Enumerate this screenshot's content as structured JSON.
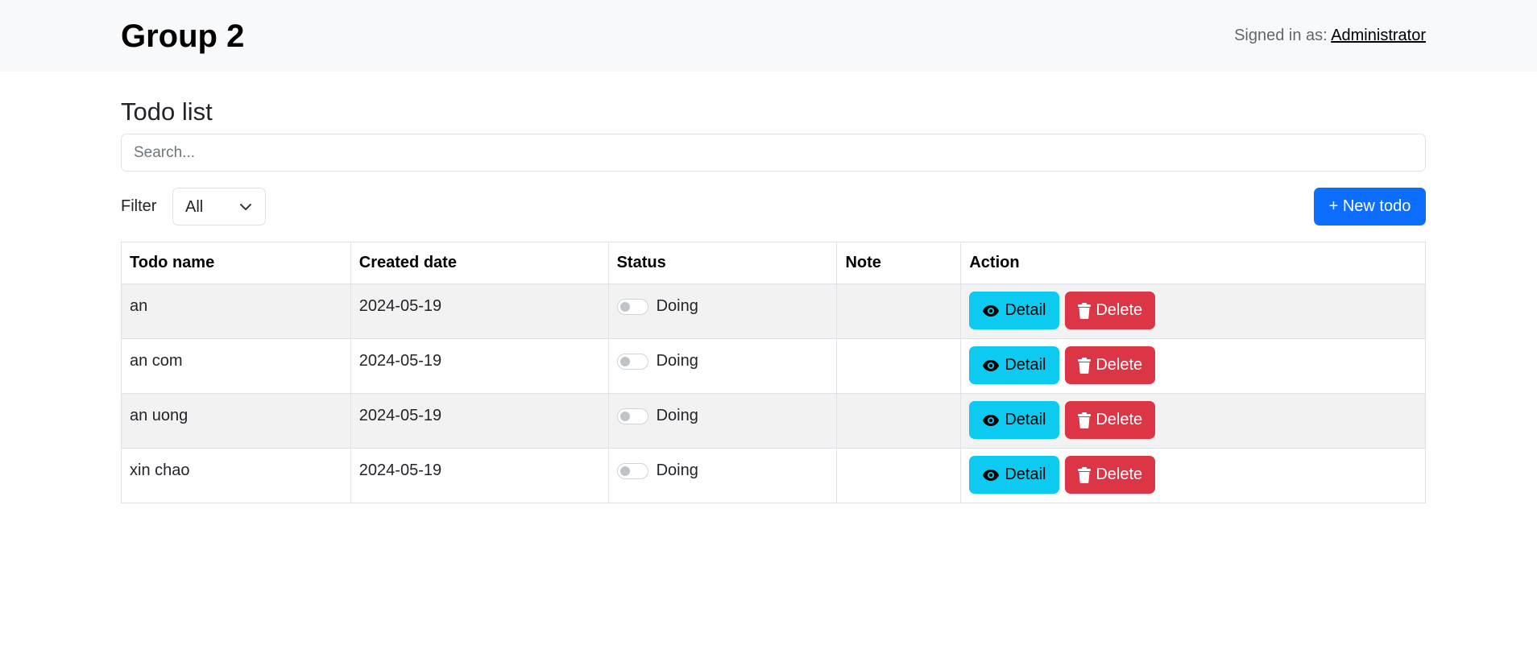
{
  "header": {
    "brand": "Group 2",
    "signed_in_label": "Signed in as:",
    "user": "Administrator"
  },
  "main": {
    "title": "Todo list",
    "search_placeholder": "Search...",
    "filter_label": "Filter",
    "filter_value": "All",
    "new_button": "+ New todo"
  },
  "table": {
    "columns": [
      "Todo name",
      "Created date",
      "Status",
      "Note",
      "Action"
    ],
    "rows": [
      {
        "name": "an",
        "created": "2024-05-19",
        "status": "Doing",
        "note": "",
        "done": false
      },
      {
        "name": "an com",
        "created": "2024-05-19",
        "status": "Doing",
        "note": "",
        "done": false
      },
      {
        "name": "an uong",
        "created": "2024-05-19",
        "status": "Doing",
        "note": "",
        "done": false
      },
      {
        "name": "xin chao",
        "created": "2024-05-19",
        "status": "Doing",
        "note": "",
        "done": false
      }
    ],
    "detail_label": "Detail",
    "delete_label": "Delete"
  },
  "icons": {
    "detail": "eye-icon",
    "delete": "trash-icon",
    "filter": "chevron-down-icon"
  },
  "colors": {
    "primary": "#0d6efd",
    "info": "#0dcaf0",
    "danger": "#dc3545",
    "navbar_bg": "#f8f9fa"
  }
}
